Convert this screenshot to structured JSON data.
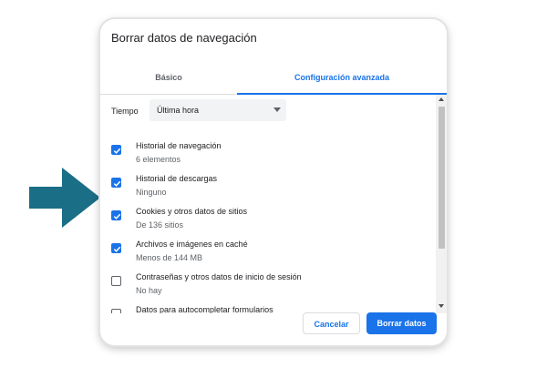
{
  "colors": {
    "arrow": "#1a6e86",
    "accent": "#1a73e8",
    "text": "#202124",
    "secondary_text": "#5f6368"
  },
  "dialog": {
    "title": "Borrar datos de navegación",
    "tabs": [
      {
        "label": "Básico",
        "active": false
      },
      {
        "label": "Configuración avanzada",
        "active": true
      }
    ],
    "time_range": {
      "label": "Tiempo",
      "selected": "Última hora"
    },
    "items": [
      {
        "label": "Historial de navegación",
        "detail": "6 elementos",
        "checked": true
      },
      {
        "label": "Historial de descargas",
        "detail": "Ninguno",
        "checked": true
      },
      {
        "label": "Cookies y otros datos de sitios",
        "detail": "De 136 sitios",
        "checked": true
      },
      {
        "label": "Archivos e imágenes en caché",
        "detail": "Menos de 144 MB",
        "checked": true
      },
      {
        "label": "Contraseñas y otros datos de inicio de sesión",
        "detail": "No hay",
        "checked": false
      },
      {
        "label": "Datos para autocompletar formularios",
        "detail": "",
        "checked": false
      }
    ],
    "buttons": {
      "cancel": "Cancelar",
      "confirm": "Borrar datos"
    }
  }
}
